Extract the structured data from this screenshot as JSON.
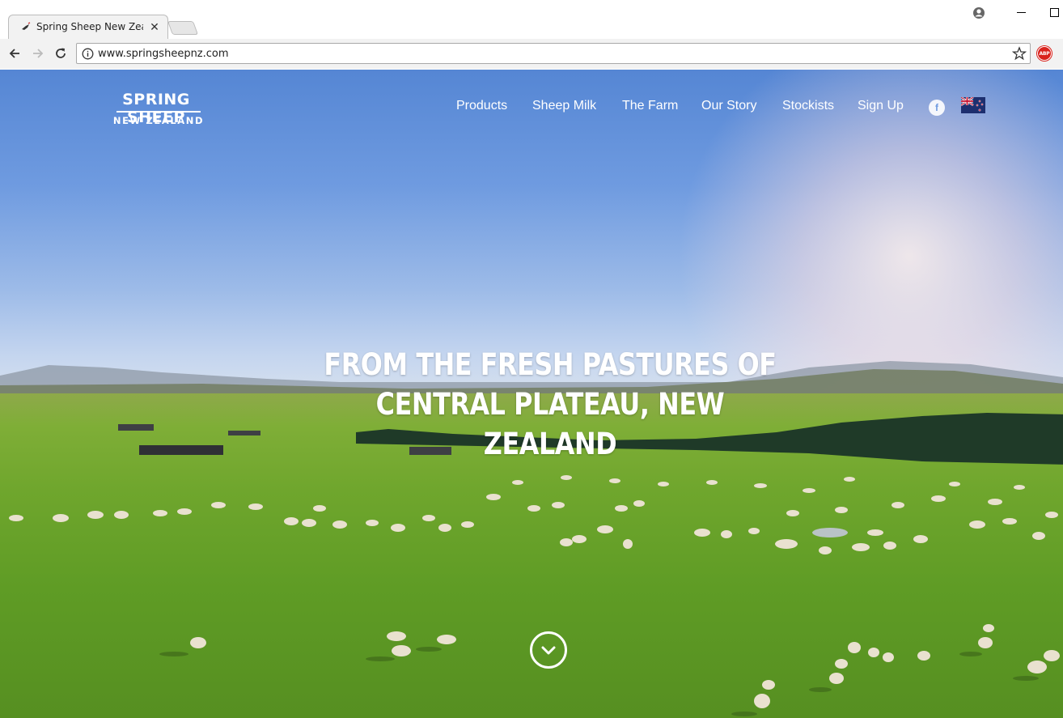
{
  "browser": {
    "tab_title": "Spring Sheep New Zealand",
    "tab_close": "✕",
    "url": "www.springsheepnz.com",
    "adblock_label": "ABP"
  },
  "site": {
    "logo_top": "SPRING SHEEP",
    "logo_bottom": "NEW ZEALAND",
    "nav": [
      {
        "label": "Products"
      },
      {
        "label": "Sheep Milk"
      },
      {
        "label": "The Farm"
      },
      {
        "label": "Our Story"
      },
      {
        "label": "Stockists"
      },
      {
        "label": "Sign Up"
      }
    ],
    "facebook_glyph": "f",
    "flag_icon": "new-zealand-flag-icon",
    "headline_line1": "FROM THE FRESH PASTURES OF",
    "headline_line2": "CENTRAL PLATEAU, NEW ZEALAND"
  },
  "colors": {
    "sky_top": "#5586d4",
    "grass": "#6fa62d",
    "abp_red": "#d9221c"
  }
}
